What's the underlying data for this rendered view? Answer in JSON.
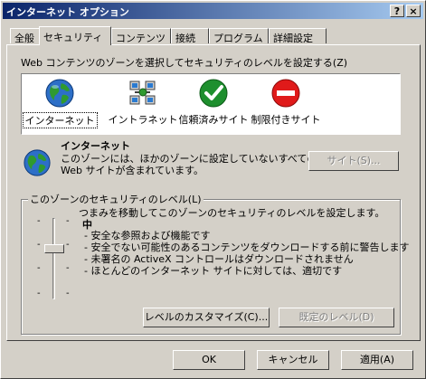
{
  "window": {
    "title": "インターネット オプション",
    "help_btn": "?",
    "close_btn": "×"
  },
  "tabs": [
    {
      "label": "全般",
      "active": false
    },
    {
      "label": "セキュリティ",
      "active": true
    },
    {
      "label": "コンテンツ",
      "active": false
    },
    {
      "label": "接続",
      "active": false
    },
    {
      "label": "プログラム",
      "active": false
    },
    {
      "label": "詳細設定",
      "active": false
    }
  ],
  "zones": {
    "instruction": "Web コンテンツのゾーンを選択してセキュリティのレベルを設定する(Z)",
    "items": [
      {
        "label": "インターネット",
        "icon": "globe-icon",
        "selected": true
      },
      {
        "label": "イントラネット",
        "icon": "intranet-icon",
        "selected": false
      },
      {
        "label": "信頼済みサイト",
        "icon": "checkmark-icon",
        "selected": false
      },
      {
        "label": "制限付きサイト",
        "icon": "no-entry-icon",
        "selected": false
      }
    ]
  },
  "zone_info": {
    "title": "インターネット",
    "desc_line1": "このゾーンには、ほかのゾーンに設定していないすべての",
    "desc_line2": "Web サイトが含まれています。",
    "sites_button": "サイト(S)..."
  },
  "security": {
    "group_title": "このゾーンのセキュリティのレベル(L)",
    "instruction": "つまみを移動してこのゾーンのセキュリティのレベルを設定します。",
    "level": "中",
    "level_fraction": 0.4,
    "bullets": [
      "- 安全な参照および機能です",
      "- 安全でない可能性のあるコンテンツをダウンロードする前に警告します",
      "- 未署名の ActiveX コントロールはダウンロードされません",
      "- ほとんどのインターネット サイトに対しては、適切です"
    ],
    "custom_button": "レベルのカスタマイズ(C)...",
    "default_button": "既定のレベル(D)"
  },
  "footer": {
    "ok": "OK",
    "cancel": "キャンセル",
    "apply": "適用(A)"
  },
  "colors": {
    "titlebar_start": "#0a246a",
    "titlebar_end": "#a6caf0",
    "face": "#d4d0c8"
  }
}
